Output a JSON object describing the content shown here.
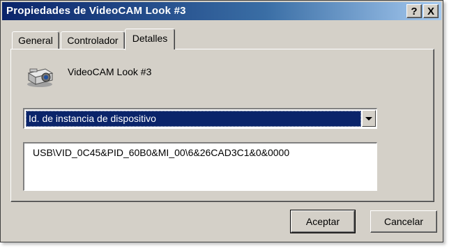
{
  "window": {
    "title": "Propiedades de VideoCAM Look #3",
    "help_symbol": "?",
    "close_symbol": "X"
  },
  "tabs": [
    {
      "label": "General",
      "selected": false
    },
    {
      "label": "Controlador",
      "selected": false
    },
    {
      "label": "Detalles",
      "selected": true
    }
  ],
  "device": {
    "icon": "webcam-icon",
    "name": "VideoCAM Look #3"
  },
  "property_select": {
    "selected": "Id. de instancia de dispositivo"
  },
  "property_value": "USB\\VID_0C45&PID_60B0&MI_00\\6&26CAD3C1&0&0000",
  "buttons": {
    "ok": "Aceptar",
    "cancel": "Cancelar"
  },
  "colors": {
    "title_bar": "#0a246a",
    "dialog_face": "#d4d0c8",
    "selection": "#0a246a"
  }
}
